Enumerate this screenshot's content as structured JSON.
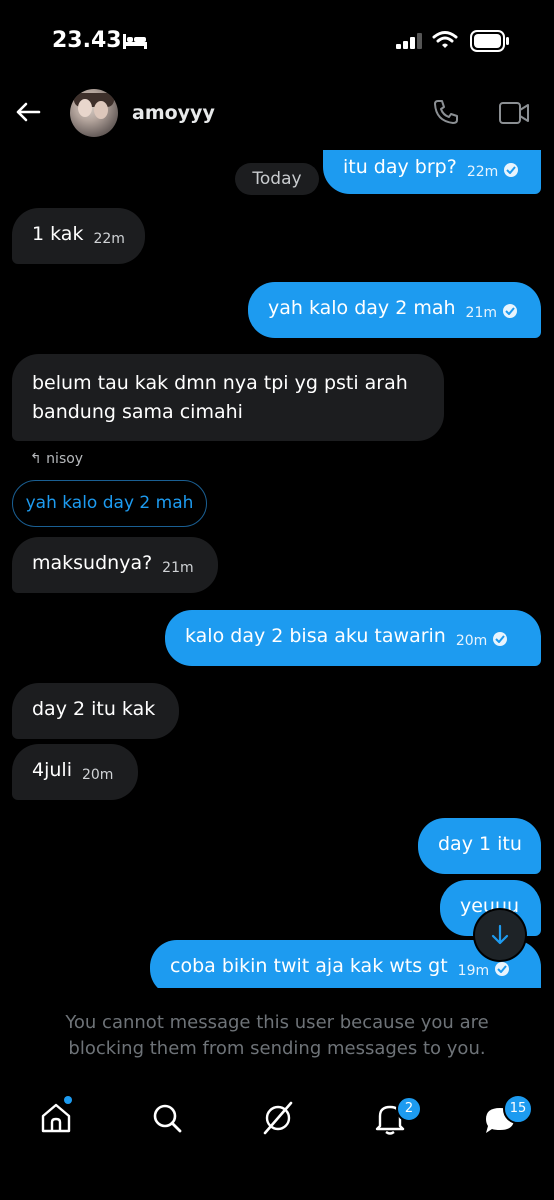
{
  "status_bar": {
    "time": "23.43"
  },
  "header": {
    "contact_name": "amoyyy"
  },
  "chat": {
    "date_separator": "Today",
    "messages": [
      {
        "text": "itu day brp?",
        "time": "22m"
      },
      {
        "text": "1 kak",
        "time": "22m"
      },
      {
        "text": "yah kalo day 2 mah",
        "time": "21m"
      },
      {
        "text_line1": "belum tau kak dmn nya tpi yg psti arah",
        "text_line2": "bandung sama cimahi"
      },
      {
        "text": "maksudnya?",
        "time": "21m"
      },
      {
        "text": "kalo day 2 bisa aku tawarin",
        "time": "20m"
      },
      {
        "text": "day 2 itu kak"
      },
      {
        "text": "4juli",
        "time": "20m"
      },
      {
        "text": "day 1 itu"
      },
      {
        "text": "yeuuu"
      },
      {
        "text": "coba bikin twit aja kak wts gt",
        "time": "19m"
      }
    ],
    "reply_label": "↰ nisoy",
    "quoted_text": "yah kalo day 2 mah"
  },
  "blocked_notice": "You cannot message this user because you are blocking them from sending messages to you.",
  "nav": {
    "notifications_badge": "2",
    "messages_badge": "15"
  },
  "colors": {
    "accent": "#1d9bf0",
    "received_bubble": "#1c1d1f",
    "background": "#000000"
  }
}
